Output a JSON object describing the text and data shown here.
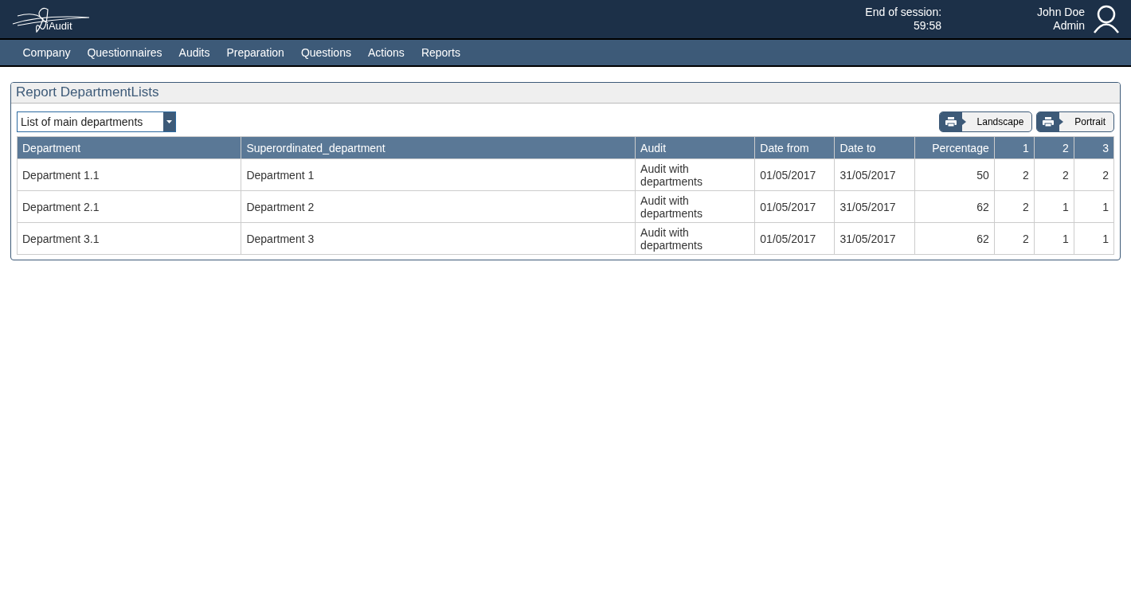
{
  "header": {
    "logo_text": "iAudit",
    "session_label": "End of session:",
    "session_time": "59:58",
    "user_name": "John Doe",
    "user_role": "Admin"
  },
  "nav": [
    "Company",
    "Questionnaires",
    "Audits",
    "Preparation",
    "Questions",
    "Actions",
    "Reports"
  ],
  "panel": {
    "title": "Report DepartmentLists",
    "select": {
      "value": "List of main departments"
    },
    "buttons": [
      "Landscape",
      "Portrait"
    ]
  },
  "table": {
    "columns": [
      {
        "label": "Department",
        "kind": "text"
      },
      {
        "label": "Superordinated_department",
        "kind": "text"
      },
      {
        "label": "Audit",
        "kind": "text"
      },
      {
        "label": "Date from",
        "kind": "text"
      },
      {
        "label": "Date to",
        "kind": "text"
      },
      {
        "label": "Percentage",
        "kind": "number"
      },
      {
        "label": "1",
        "kind": "number"
      },
      {
        "label": "2",
        "kind": "number"
      },
      {
        "label": "3",
        "kind": "number"
      }
    ],
    "rows": [
      [
        "Department 1.1",
        "Department 1",
        "Audit with departments",
        "01/05/2017",
        "31/05/2017",
        "50",
        "2",
        "2",
        "2"
      ],
      [
        "Department 2.1",
        "Department 2",
        "Audit with departments",
        "01/05/2017",
        "31/05/2017",
        "62",
        "2",
        "1",
        "1"
      ],
      [
        "Department 3.1",
        "Department 3",
        "Audit with departments",
        "01/05/2017",
        "31/05/2017",
        "62",
        "2",
        "1",
        "1"
      ]
    ]
  }
}
